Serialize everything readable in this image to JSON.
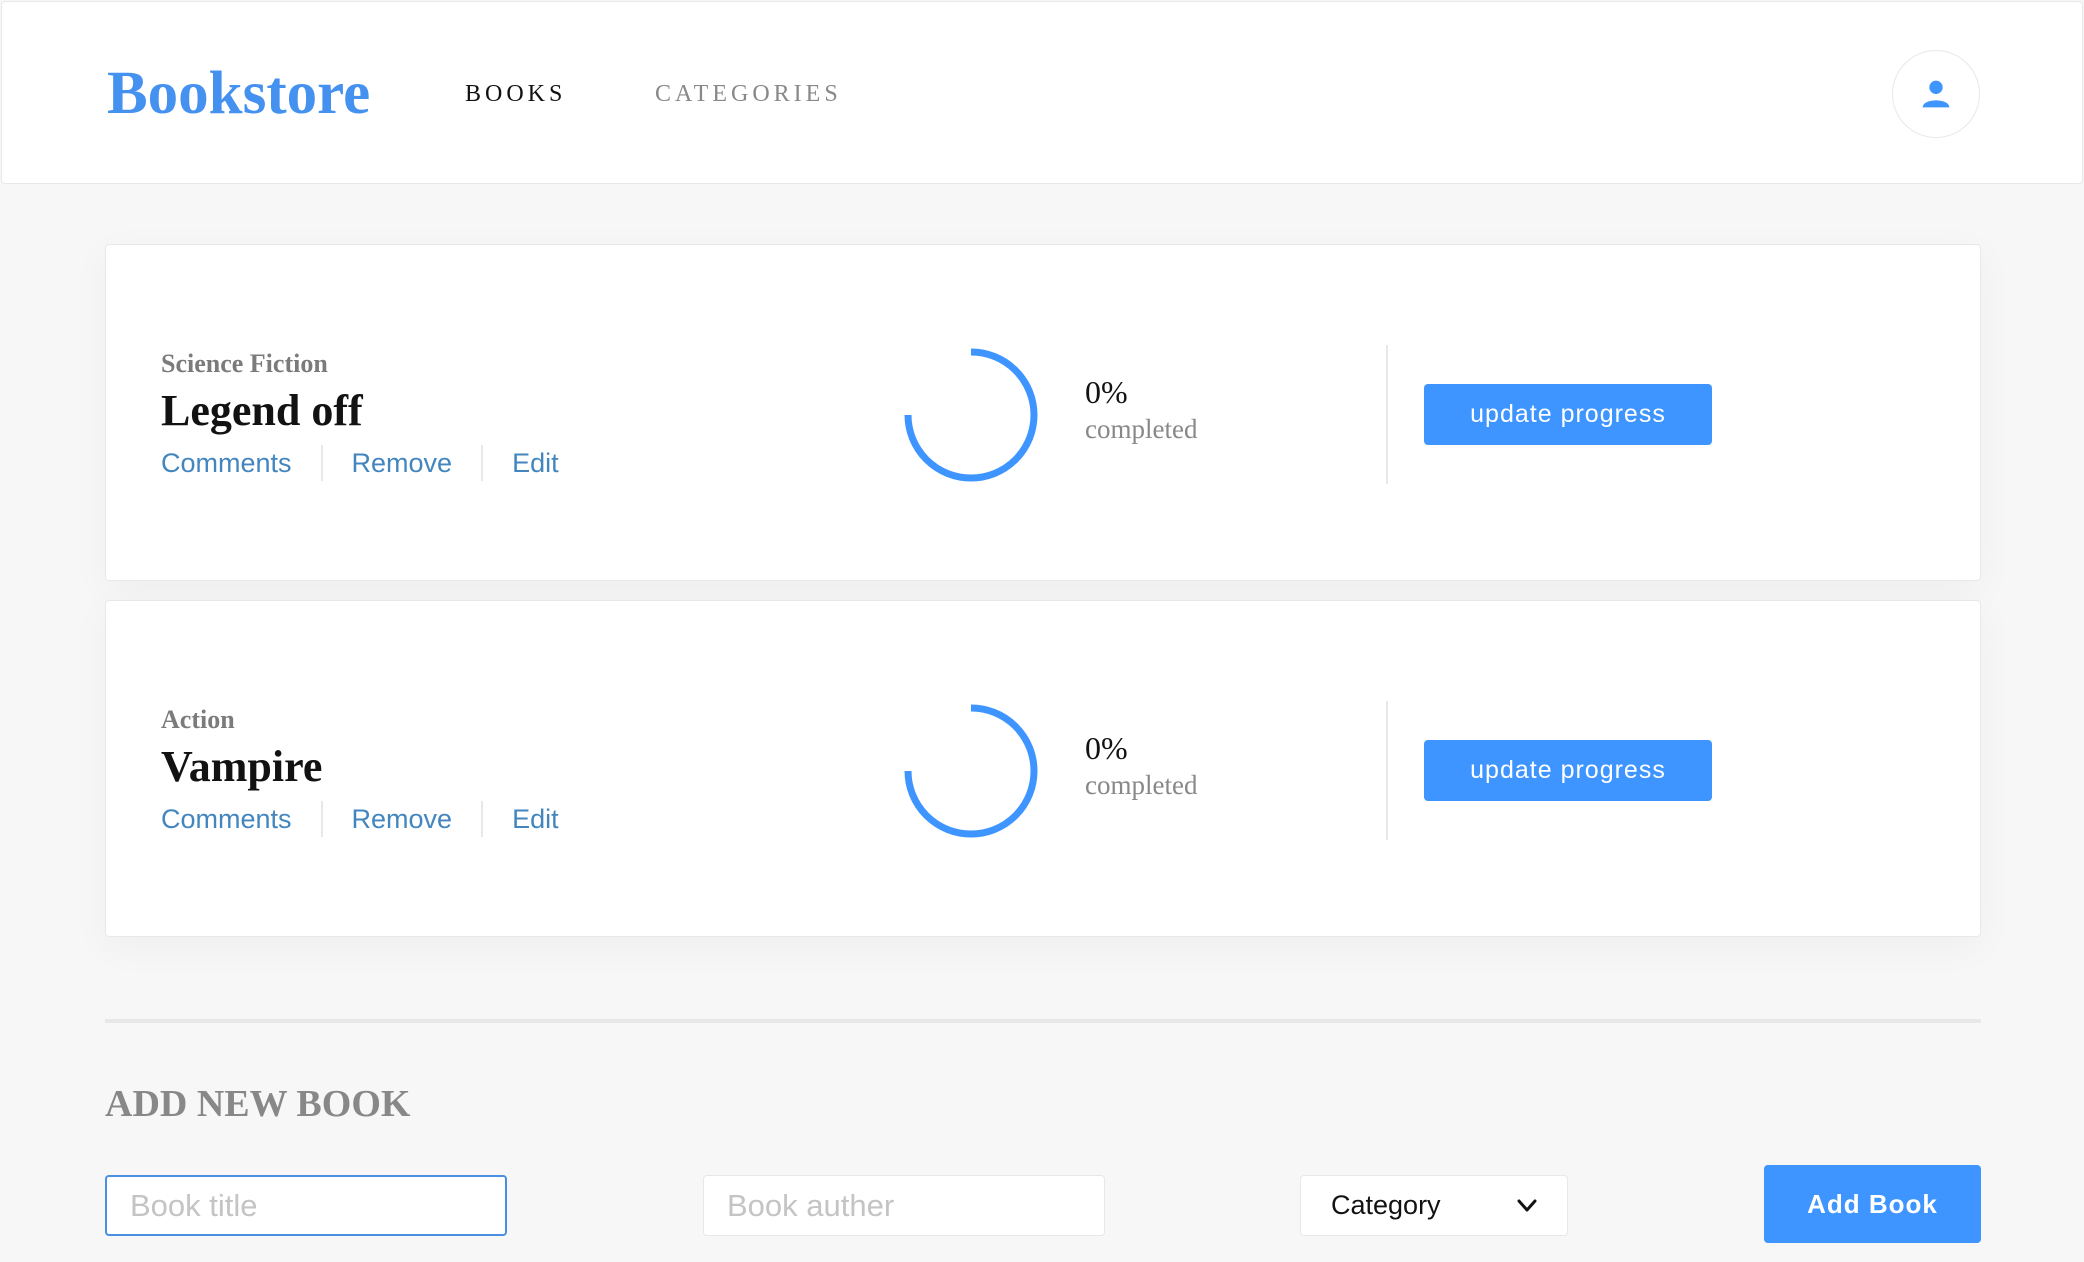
{
  "header": {
    "logo": "Bookstore",
    "nav": [
      {
        "label": "BOOKS",
        "active": true
      },
      {
        "label": "CATEGORIES",
        "active": false
      }
    ],
    "user_icon": "user-icon"
  },
  "books": [
    {
      "genre": "Science Fiction",
      "title": "Legend off",
      "actions": [
        "Comments",
        "Remove",
        "Edit"
      ],
      "progress_percent": "0%",
      "progress_value": 0,
      "progress_label": "completed",
      "update_label": "update progress"
    },
    {
      "genre": "Action",
      "title": "Vampire",
      "actions": [
        "Comments",
        "Remove",
        "Edit"
      ],
      "progress_percent": "0%",
      "progress_value": 0,
      "progress_label": "completed",
      "update_label": "update progress"
    }
  ],
  "form": {
    "heading": "ADD NEW BOOK",
    "title_placeholder": "Book title",
    "author_placeholder": "Book auther",
    "category_selected": "Category",
    "submit_label": "Add Book"
  },
  "colors": {
    "accent": "#3e95ff",
    "logo": "#4591f0",
    "link": "#4386bf"
  }
}
